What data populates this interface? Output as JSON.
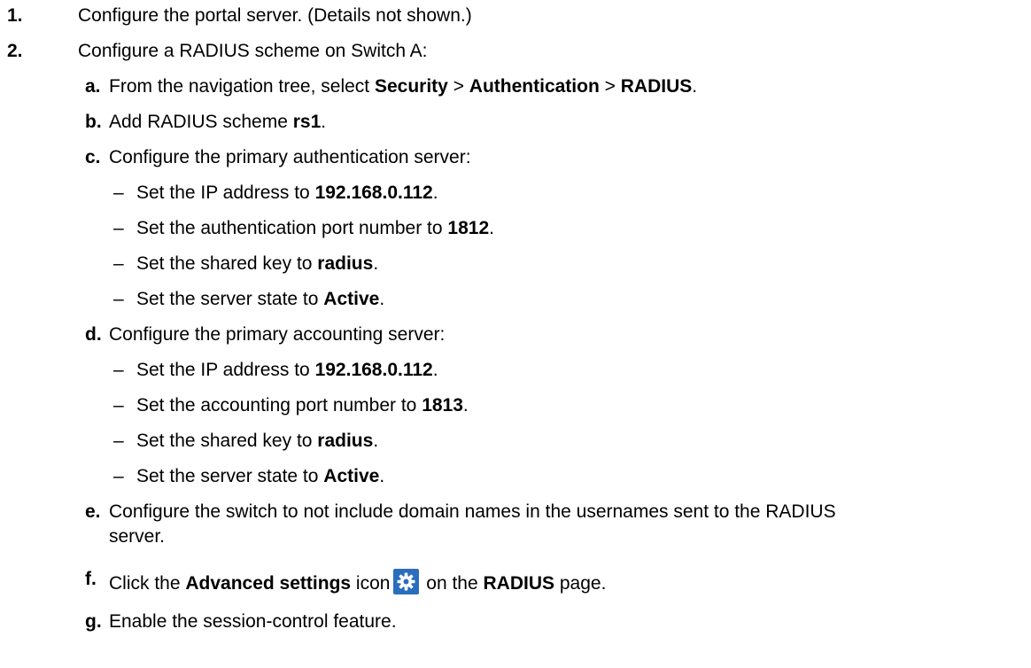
{
  "steps": [
    {
      "num": "1.",
      "text": "Configure the portal server. (Details not shown.)"
    },
    {
      "num": "2.",
      "text": "Configure a RADIUS scheme on Switch A:"
    }
  ],
  "substeps": {
    "a": {
      "label": "a.",
      "t1": "From the navigation tree, select ",
      "b1": "Security",
      "s1": " > ",
      "b2": "Authentication",
      "s2": " > ",
      "b3": "RADIUS",
      "end": "."
    },
    "b": {
      "label": "b.",
      "t1": "Add RADIUS scheme ",
      "b1": "rs1",
      "end": "."
    },
    "c": {
      "label": "c.",
      "text": "Configure the primary authentication server:"
    },
    "d": {
      "label": "d.",
      "text": "Configure the primary accounting server:"
    },
    "e": {
      "label": "e.",
      "line1": "Configure the switch to not include domain names in the usernames sent to the RADIUS",
      "line2": "server."
    },
    "f": {
      "label": "f.",
      "t1": "Click the ",
      "b1": "Advanced settings",
      "t2": " icon",
      "t3": " on the ",
      "b2": "RADIUS",
      "end": " page."
    },
    "g": {
      "label": "g.",
      "text": "Enable the session-control feature."
    }
  },
  "auth_items": [
    {
      "dash": "–",
      "t": "Set the IP address to ",
      "v": "192.168.0.112",
      "end": "."
    },
    {
      "dash": "–",
      "t": "Set the authentication port number to ",
      "v": "1812",
      "end": "."
    },
    {
      "dash": "–",
      "t": "Set the shared key to ",
      "v": "radius",
      "end": "."
    },
    {
      "dash": "–",
      "t": "Set the server state to ",
      "v": "Active",
      "end": "."
    }
  ],
  "acct_items": [
    {
      "dash": "–",
      "t": "Set the IP address to ",
      "v": "192.168.0.112",
      "end": "."
    },
    {
      "dash": "–",
      "t": "Set the accounting port number to ",
      "v": "1813",
      "end": "."
    },
    {
      "dash": "–",
      "t": "Set the shared key to ",
      "v": "radius",
      "end": "."
    },
    {
      "dash": "–",
      "t": "Set the server state to ",
      "v": "Active",
      "end": "."
    }
  ],
  "icons": {
    "advanced_settings": "gear-icon",
    "accent": "#2a6ebd"
  }
}
